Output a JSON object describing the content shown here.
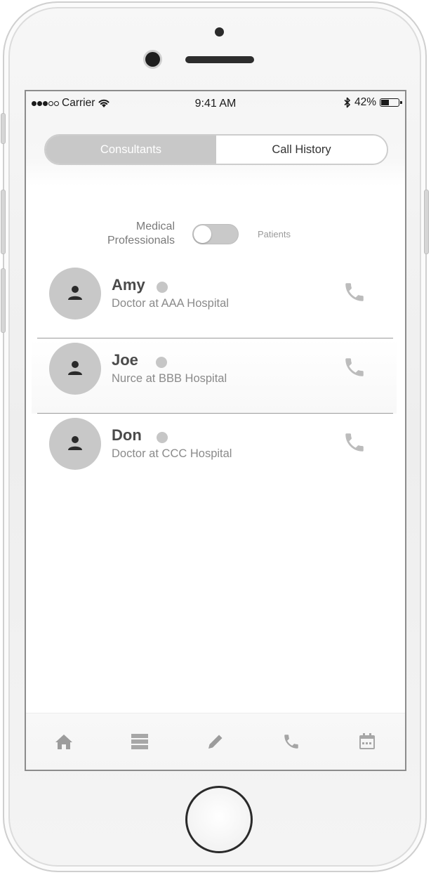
{
  "status_bar": {
    "carrier": "Carrier",
    "time": "9:41 AM",
    "battery": "42%",
    "signal_dots_filled": 3,
    "signal_dots_total": 5,
    "icons": [
      "wifi-icon",
      "bluetooth-icon",
      "battery-icon"
    ]
  },
  "segmented_control": {
    "tabs": [
      {
        "label": "Consultants",
        "selected": true
      },
      {
        "label": "Call History",
        "selected": false
      }
    ]
  },
  "filter_toggle": {
    "left_label_line1": "Medical",
    "left_label_line2": "Professionals",
    "right_label": "Patients",
    "state": "off"
  },
  "contacts": [
    {
      "name": "Amy",
      "role": "Doctor at AAA Hospital",
      "status_color": "#c6c6c6"
    },
    {
      "name": "Joe",
      "role": "Nurce at BBB Hospital",
      "status_color": "#c6c6c6"
    },
    {
      "name": "Don",
      "role": "Doctor at CCC Hospital",
      "status_color": "#c6c6c6"
    }
  ],
  "tab_bar": {
    "items": [
      "home-icon",
      "list-icon",
      "pencil-icon",
      "phone-icon",
      "calendar-icon"
    ]
  },
  "colors": {
    "accent_gray": "#c8c8c8",
    "text_dark": "#4a4a4a",
    "text_muted": "#8a8a8a"
  }
}
